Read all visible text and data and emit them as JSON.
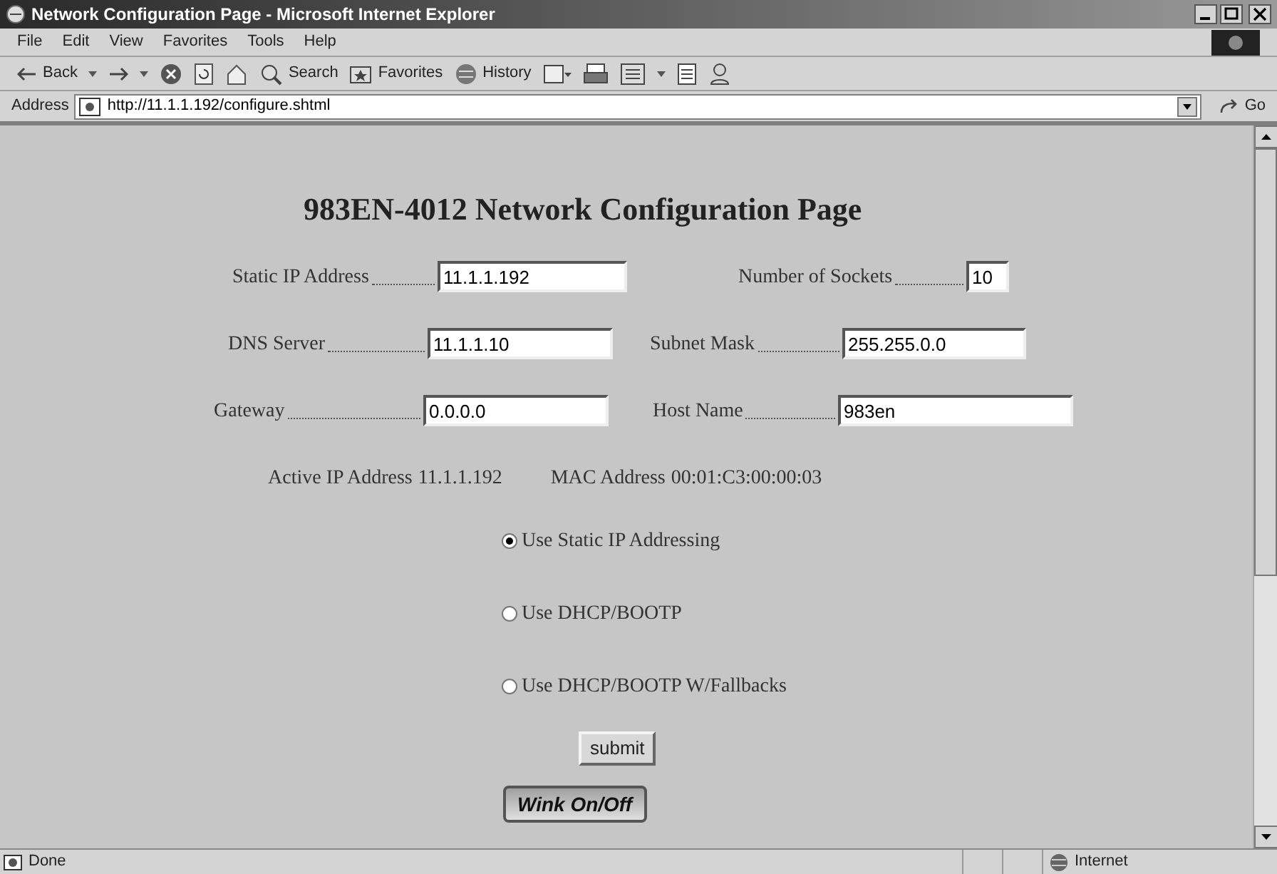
{
  "window": {
    "title": "Network Configuration Page - Microsoft Internet Explorer"
  },
  "menu": [
    "File",
    "Edit",
    "View",
    "Favorites",
    "Tools",
    "Help"
  ],
  "toolbar": {
    "back": "Back",
    "search": "Search",
    "favorites": "Favorites",
    "history": "History"
  },
  "address": {
    "label": "Address",
    "url": "http://11.1.1.192/configure.shtml",
    "go": "Go"
  },
  "page": {
    "title": "983EN-4012 Network Configuration Page",
    "field_rows": [
      [
        {
          "label": "Static IP Address",
          "value": "11.1.1.192"
        },
        {
          "label": "Number of Sockets",
          "value": "10"
        }
      ],
      [
        {
          "label": "DNS Server",
          "value": "11.1.1.10"
        },
        {
          "label": "Subnet Mask",
          "value": "255.255.0.0"
        }
      ],
      [
        {
          "label": "Gateway",
          "value": "0.0.0.0"
        },
        {
          "label": "Host Name",
          "value": "983en"
        }
      ]
    ],
    "active_ip": {
      "label": "Active IP Address",
      "value": "11.1.1.192"
    },
    "mac": {
      "label": "MAC Address",
      "value": "00:01:C3:00:00:03"
    },
    "radios": [
      {
        "label": "Use Static IP Addressing",
        "selected": true
      },
      {
        "label": "Use DHCP/BOOTP",
        "selected": false
      },
      {
        "label": "Use DHCP/BOOTP W/Fallbacks",
        "selected": false
      }
    ],
    "submit": "submit",
    "wink": "Wink On/Off"
  },
  "status_bar": {
    "text": "Done",
    "zone": "Internet"
  }
}
